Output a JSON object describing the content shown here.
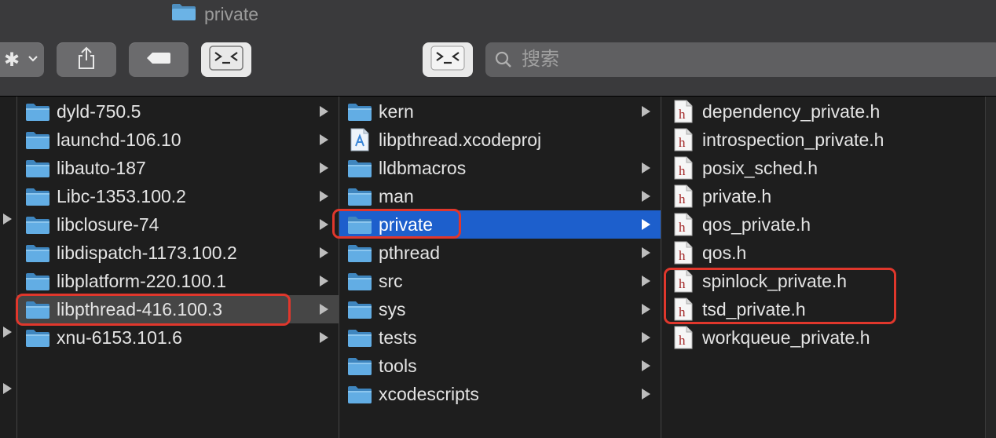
{
  "window": {
    "title": "private"
  },
  "toolbar": {
    "search_placeholder": "搜索"
  },
  "column1": {
    "items": [
      {
        "label": "dyld-750.5"
      },
      {
        "label": "launchd-106.10"
      },
      {
        "label": "libauto-187"
      },
      {
        "label": "Libc-1353.100.2"
      },
      {
        "label": "libclosure-74"
      },
      {
        "label": "libdispatch-1173.100.2"
      },
      {
        "label": "libplatform-220.100.1"
      },
      {
        "label": "libpthread-416.100.3"
      },
      {
        "label": "xnu-6153.101.6"
      }
    ]
  },
  "column2": {
    "items": [
      {
        "label": "kern"
      },
      {
        "label": "libpthread.xcodeproj"
      },
      {
        "label": "lldbmacros"
      },
      {
        "label": "man"
      },
      {
        "label": "private"
      },
      {
        "label": "pthread"
      },
      {
        "label": "src"
      },
      {
        "label": "sys"
      },
      {
        "label": "tests"
      },
      {
        "label": "tools"
      },
      {
        "label": "xcodescripts"
      }
    ]
  },
  "column3": {
    "items": [
      {
        "label": "dependency_private.h"
      },
      {
        "label": "introspection_private.h"
      },
      {
        "label": "posix_sched.h"
      },
      {
        "label": "private.h"
      },
      {
        "label": "qos_private.h"
      },
      {
        "label": "qos.h"
      },
      {
        "label": "spinlock_private.h"
      },
      {
        "label": "tsd_private.h"
      },
      {
        "label": "workqueue_private.h"
      }
    ]
  },
  "colors": {
    "selection_blue": "#1d5fcc",
    "selection_gray": "#464646",
    "highlight_red": "#e0372c",
    "folder_blue": "#5aa6da"
  },
  "icons": {
    "folder": "folder-icon",
    "xcodeproj": "xcode-project-icon",
    "header": "header-file-icon"
  }
}
